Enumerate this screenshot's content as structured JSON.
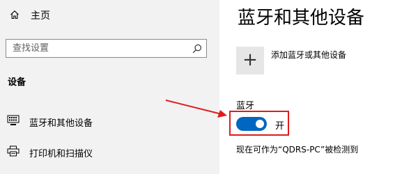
{
  "sidebar": {
    "home_label": "主页",
    "search_placeholder": "查找设置",
    "section_title": "设备",
    "items": [
      {
        "label": "蓝牙和其他设备",
        "icon": "keyboard-icon"
      },
      {
        "label": "打印机和扫描仪",
        "icon": "printer-icon"
      }
    ]
  },
  "main": {
    "title": "蓝牙和其他设备",
    "add_device_label": "添加蓝牙或其他设备",
    "bluetooth_label": "蓝牙",
    "bluetooth_toggle": {
      "on": true,
      "state_text": "开"
    },
    "discoverable_text": "现在可作为“QDRS-PC”被检测到"
  },
  "colors": {
    "accent": "#0067c0",
    "annotation": "#e01b1b",
    "sidebar_bg": "#f2f2f2"
  }
}
